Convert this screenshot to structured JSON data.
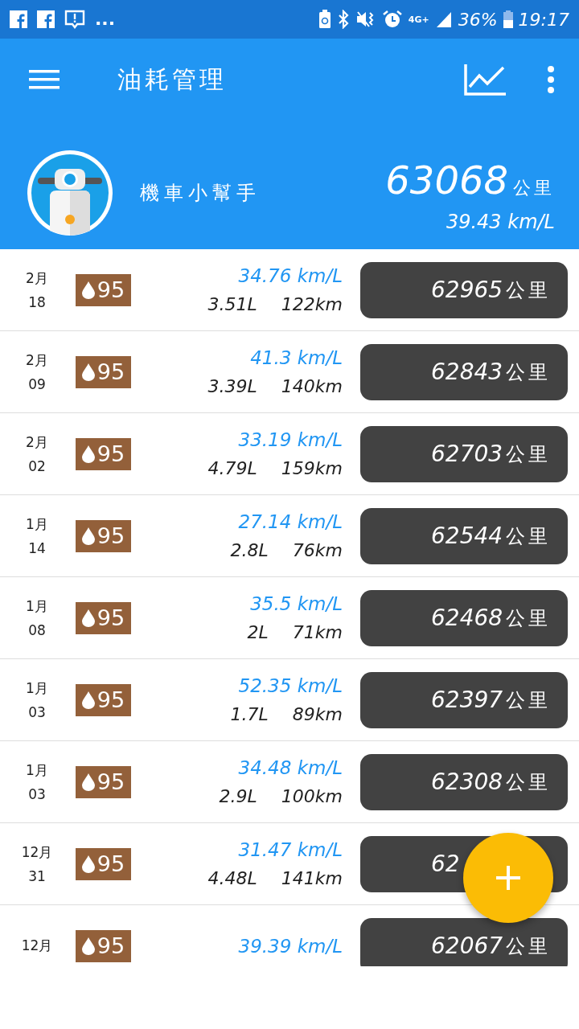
{
  "status_bar": {
    "battery": "36%",
    "time": "19:17",
    "network": "4G+",
    "more": "..."
  },
  "app_bar": {
    "title": "油耗管理"
  },
  "profile": {
    "name": "機車小幫手",
    "total_distance": "63068",
    "total_unit": "公里",
    "average": "39.43 km/L"
  },
  "records": [
    {
      "month": "2月",
      "day": "18",
      "fuel": "95",
      "efficiency": "34.76 km/L",
      "liters": "3.51L",
      "distance": "122km",
      "odometer": "62965",
      "unit": "公里"
    },
    {
      "month": "2月",
      "day": "09",
      "fuel": "95",
      "efficiency": "41.3 km/L",
      "liters": "3.39L",
      "distance": "140km",
      "odometer": "62843",
      "unit": "公里"
    },
    {
      "month": "2月",
      "day": "02",
      "fuel": "95",
      "efficiency": "33.19 km/L",
      "liters": "4.79L",
      "distance": "159km",
      "odometer": "62703",
      "unit": "公里"
    },
    {
      "month": "1月",
      "day": "14",
      "fuel": "95",
      "efficiency": "27.14 km/L",
      "liters": "2.8L",
      "distance": "76km",
      "odometer": "62544",
      "unit": "公里"
    },
    {
      "month": "1月",
      "day": "08",
      "fuel": "95",
      "efficiency": "35.5 km/L",
      "liters": "2L",
      "distance": "71km",
      "odometer": "62468",
      "unit": "公里"
    },
    {
      "month": "1月",
      "day": "03",
      "fuel": "95",
      "efficiency": "52.35 km/L",
      "liters": "1.7L",
      "distance": "89km",
      "odometer": "62397",
      "unit": "公里"
    },
    {
      "month": "1月",
      "day": "03",
      "fuel": "95",
      "efficiency": "34.48 km/L",
      "liters": "2.9L",
      "distance": "100km",
      "odometer": "62308",
      "unit": "公里"
    },
    {
      "month": "12月",
      "day": "31",
      "fuel": "95",
      "efficiency": "31.47 km/L",
      "liters": "4.48L",
      "distance": "141km",
      "odometer": "62"
    },
    {
      "month": "12月",
      "fuel": "95",
      "efficiency": "39.39 km/L",
      "odometer": "62067",
      "unit": "公里"
    }
  ]
}
